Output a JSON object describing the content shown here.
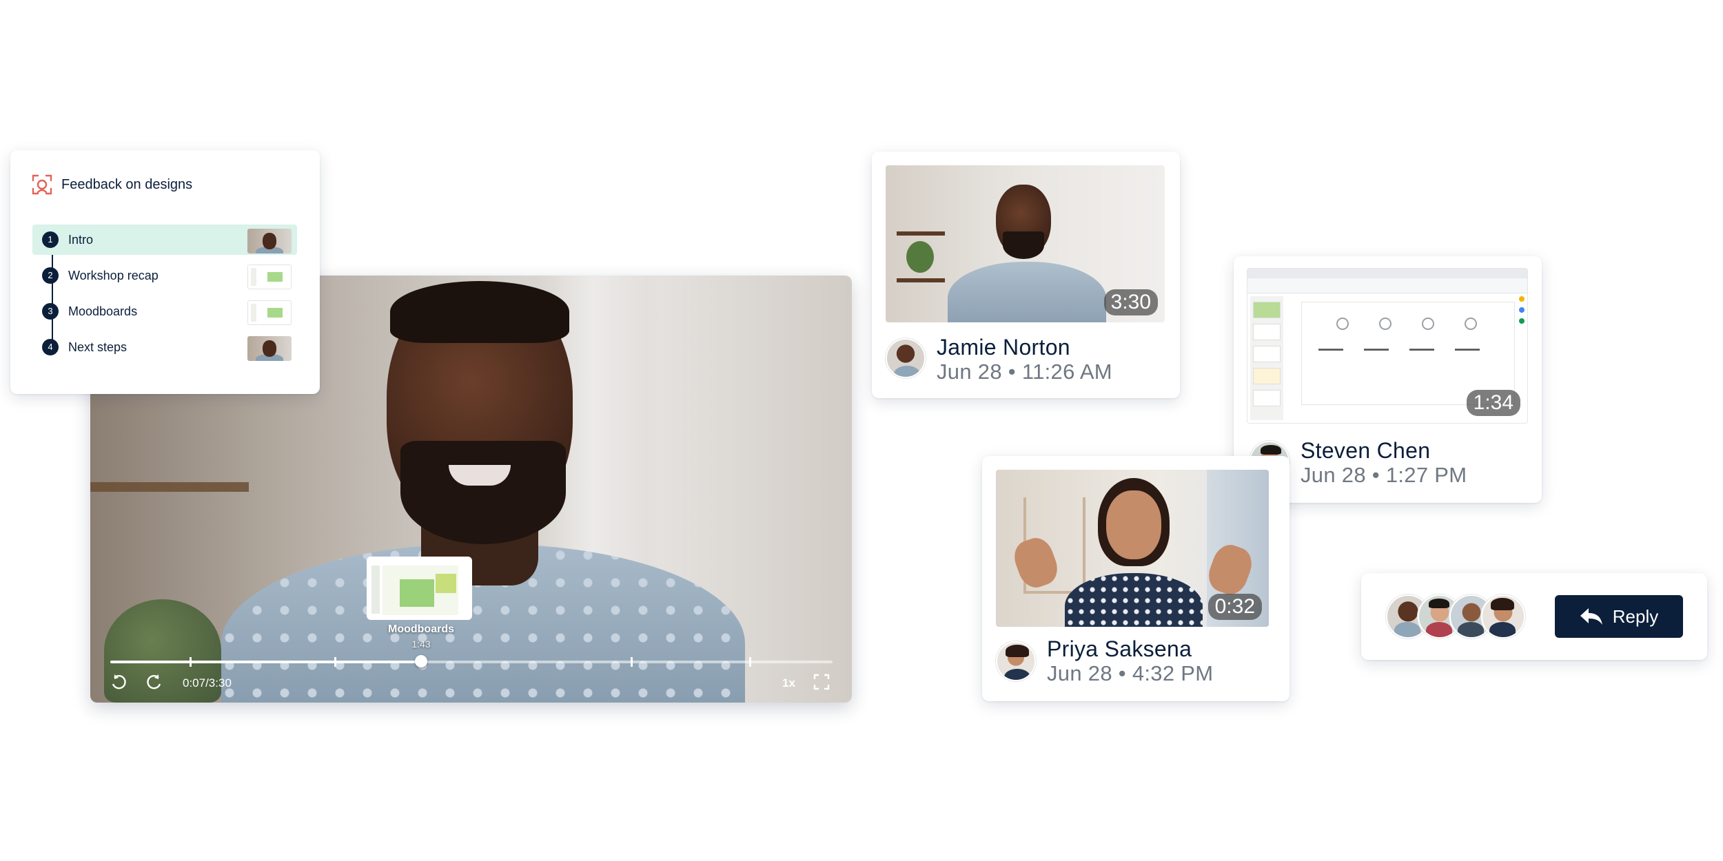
{
  "chapters": {
    "title": "Feedback on designs",
    "icon": "screen-record-icon",
    "accent": "#e0645a",
    "active_bg": "#d9f2ea",
    "items": [
      {
        "num": "1",
        "label": "Intro",
        "thumb": "person"
      },
      {
        "num": "2",
        "label": "Workshop recap",
        "thumb": "slide"
      },
      {
        "num": "3",
        "label": "Moodboards",
        "thumb": "slide"
      },
      {
        "num": "4",
        "label": "Next steps",
        "thumb": "person"
      }
    ]
  },
  "player": {
    "time": "0:07/3:30",
    "speed": "1x",
    "progress": 0.43,
    "chapter_markers": [
      0.11,
      0.31,
      0.43,
      0.72,
      0.885
    ],
    "preview": {
      "label": "Moodboards",
      "time": "1:43"
    },
    "icons": [
      "rewind-icon",
      "forward-icon",
      "fullscreen-icon"
    ]
  },
  "videos": [
    {
      "name": "Jamie Norton",
      "date": "Jun 28 • 11:26 AM",
      "duration": "3:30"
    },
    {
      "name": "Steven Chen",
      "date": "Jun 28 • 1:27 PM",
      "duration": "1:34"
    },
    {
      "name": "Priya Saksena",
      "date": "Jun 28 • 4:32 PM",
      "duration": "0:32"
    }
  ],
  "reply": {
    "label": "Reply",
    "icon": "reply-arrow-icon",
    "button_color": "#0b1e3a"
  }
}
